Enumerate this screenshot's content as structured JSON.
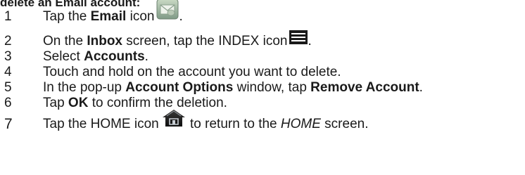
{
  "heading": "delete an Email account:",
  "steps": [
    {
      "number": "1",
      "prefix": "Tap the ",
      "bold": "Email",
      "suffix": " icon",
      "end": "."
    },
    {
      "number": "2",
      "prefix": "On the ",
      "bold": "Inbox",
      "suffix": " screen, tap the INDEX icon",
      "end": "."
    },
    {
      "number": "3",
      "prefix": "Select ",
      "bold": "Accounts",
      "end": "."
    },
    {
      "number": "4",
      "text": "Touch and hold on the account you want to delete."
    },
    {
      "number": "5",
      "prefix": "In the pop-up ",
      "bold": "Account Options",
      "middle": " window, tap ",
      "bold2": "Remove Account",
      "end": "."
    },
    {
      "number": "6",
      "prefix": "Tap ",
      "bold": "OK",
      "suffix": " to confirm the deletion."
    },
    {
      "number": "7",
      "prefix": "Tap the HOME icon",
      "middle": " to return to the ",
      "italic": "HOME",
      "end": " screen."
    }
  ],
  "icons": {
    "email": "email-app-icon",
    "index": "index-menu-icon",
    "home": "home-icon"
  }
}
